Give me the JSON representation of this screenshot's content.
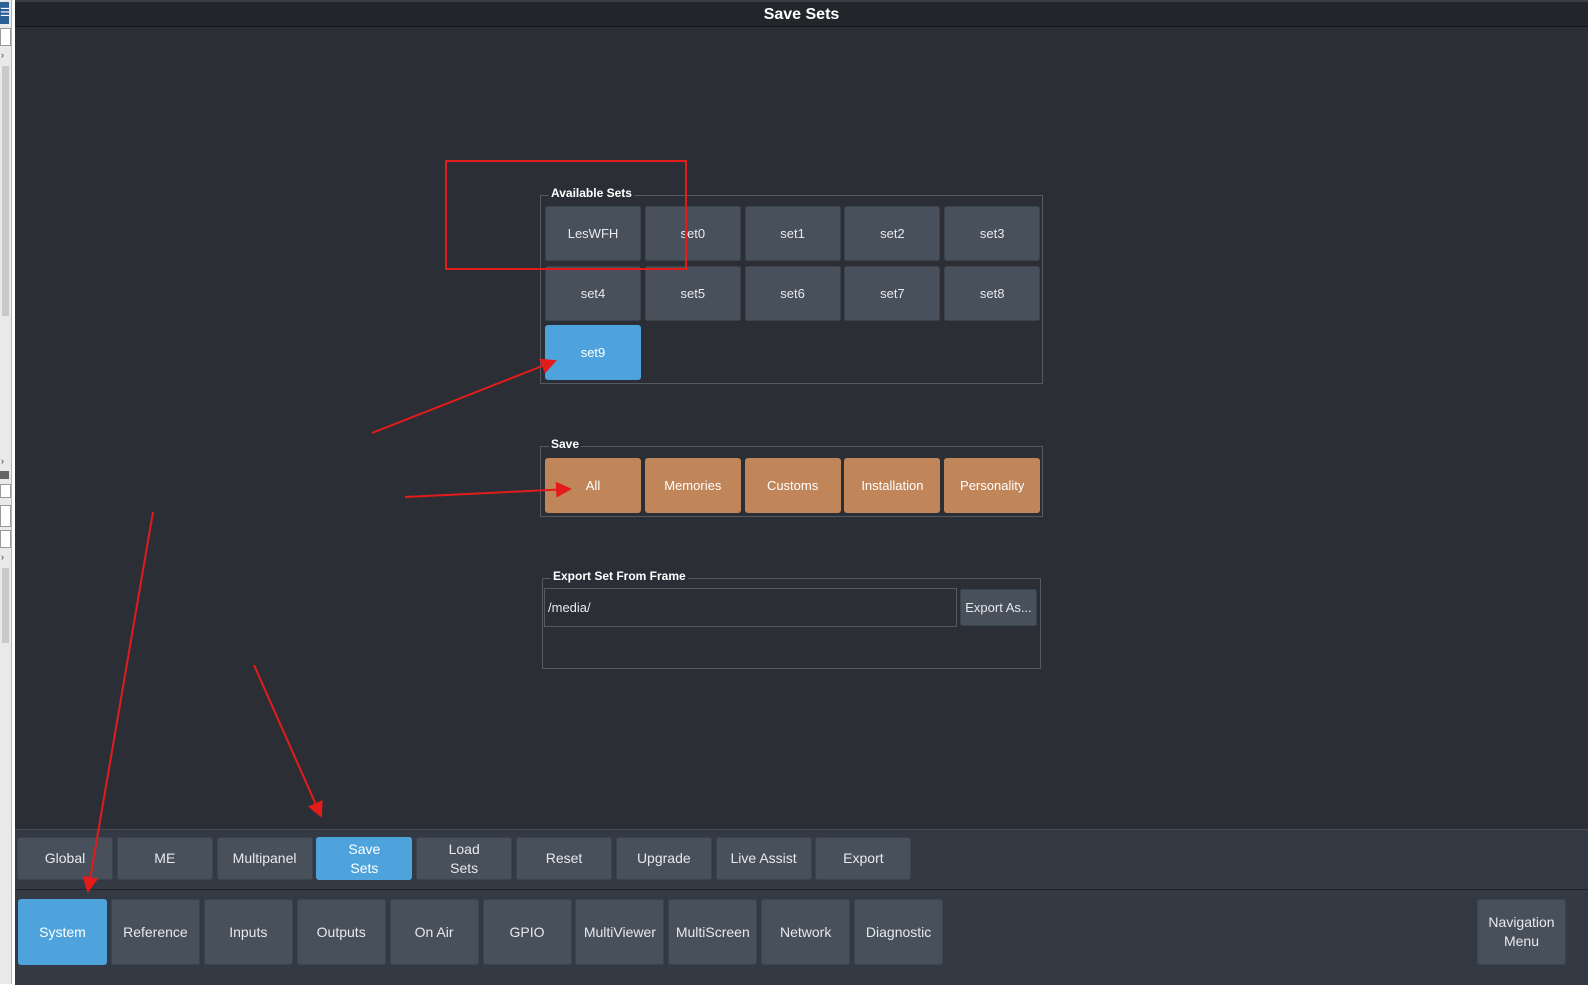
{
  "window": {
    "title": "Save Sets"
  },
  "available_sets": {
    "label": "Available Sets",
    "items": [
      "LesWFH",
      "set0",
      "set1",
      "set2",
      "set3",
      "set4",
      "set5",
      "set6",
      "set7",
      "set8",
      "set9"
    ],
    "selected": "set9"
  },
  "save": {
    "label": "Save",
    "buttons": [
      "All",
      "Memories",
      "Customs",
      "Installation",
      "Personality"
    ]
  },
  "export_set": {
    "label": "Export Set From Frame",
    "path_value": "/media/",
    "export_button": "Export As..."
  },
  "sub_tabs": {
    "items": [
      "Global",
      "ME",
      "Multipanel",
      "Save\nSets",
      "Load\nSets",
      "Reset",
      "Upgrade",
      "Live Assist",
      "Export"
    ],
    "selected": "Save\nSets"
  },
  "main_tabs": {
    "items": [
      "System",
      "Reference",
      "Inputs",
      "Outputs",
      "On Air",
      "GPIO",
      "MultiViewer",
      "MultiScreen",
      "Network",
      "Diagnostic"
    ],
    "selected": "System"
  },
  "navigation_menu_label": "Navigation\nMenu",
  "colors": {
    "background": "#2b2f35",
    "button": "#47505b",
    "selected": "#4fa3dd",
    "save_button": "#c0865a",
    "annotation": "#e31b1b"
  }
}
